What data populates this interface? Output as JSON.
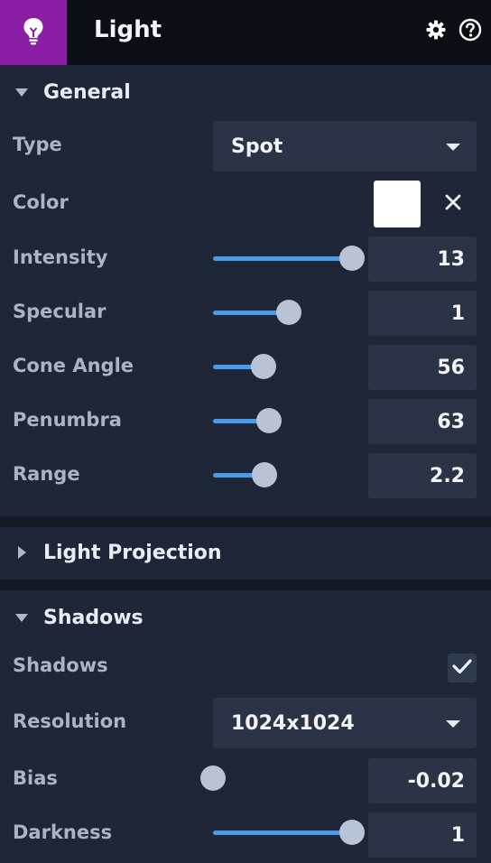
{
  "header": {
    "title": "Light",
    "badge_icon": "lightbulb-icon",
    "badge_color": "#8a1fa6",
    "icons": [
      "gear-icon",
      "help-icon"
    ]
  },
  "general": {
    "title": "General",
    "expanded": true,
    "type": {
      "label": "Type",
      "value": "Spot"
    },
    "color": {
      "label": "Color",
      "value": "#ffffff"
    },
    "intensity": {
      "label": "Intensity",
      "value": "13",
      "slider_fraction": 1.0
    },
    "specular": {
      "label": "Specular",
      "value": "1",
      "slider_fraction": 0.5
    },
    "cone_angle": {
      "label": "Cone Angle",
      "value": "56",
      "slider_fraction": 0.3
    },
    "penumbra": {
      "label": "Penumbra",
      "value": "63",
      "slider_fraction": 0.34
    },
    "range": {
      "label": "Range",
      "value": "2.2",
      "slider_fraction": 0.31
    }
  },
  "light_projection": {
    "title": "Light Projection",
    "expanded": false
  },
  "shadows": {
    "title": "Shadows",
    "expanded": true,
    "enabled": {
      "label": "Shadows",
      "checked": true
    },
    "resolution": {
      "label": "Resolution",
      "value": "1024x1024"
    },
    "bias": {
      "label": "Bias",
      "value": "-0.02",
      "slider_fraction": 0.0
    },
    "darkness": {
      "label": "Darkness",
      "value": "1",
      "slider_fraction": 1.0
    }
  },
  "colors": {
    "accent": "#4a9be8",
    "panel": "#1e2637",
    "field": "#2b3447"
  }
}
